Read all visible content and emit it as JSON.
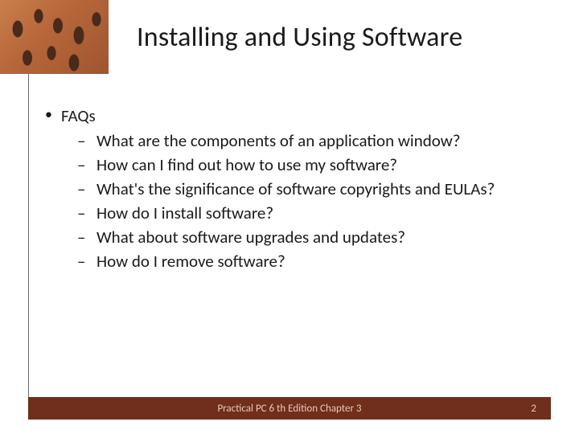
{
  "title": "Installing and Using Software",
  "bullet": {
    "label": "FAQs",
    "items": [
      "What are the components of an application window?",
      "How can I find out how to use my software?",
      "What's the significance of software copyrights and EULAs?",
      "How do I install software?",
      "What about software upgrades and updates?",
      "How do I remove software?"
    ]
  },
  "footer": {
    "text": "Practical PC 6 th Edition Chapter 3",
    "page": "2"
  },
  "colors": {
    "footer_bg": "#6f2f1a",
    "footer_fg": "#e8c8b8"
  }
}
